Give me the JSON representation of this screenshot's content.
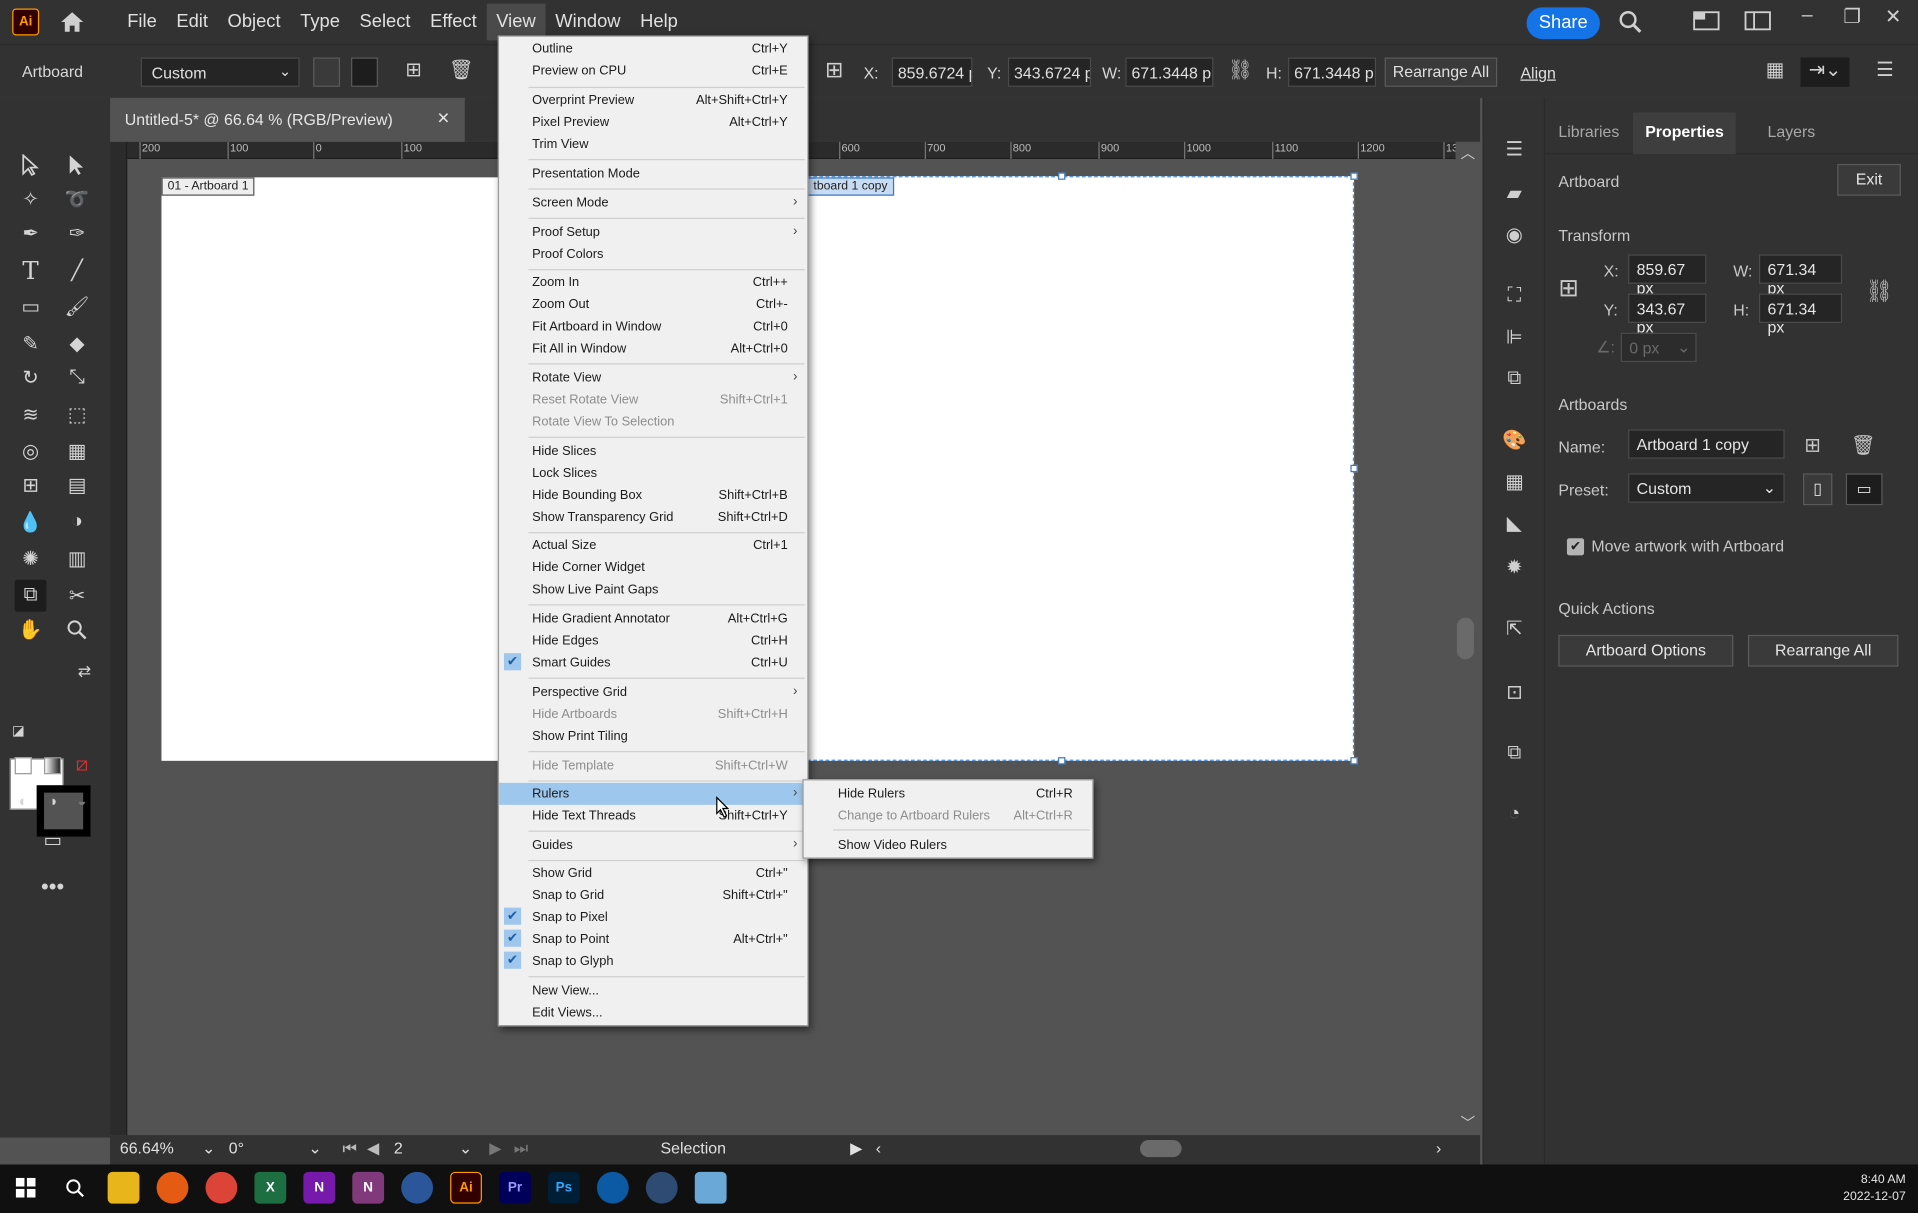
{
  "app": {
    "logo": "Ai",
    "menus": [
      "File",
      "Edit",
      "Object",
      "Type",
      "Select",
      "Effect",
      "View",
      "Window",
      "Help"
    ],
    "active_menu": "View",
    "share": "Share"
  },
  "controlbar": {
    "label": "Artboard",
    "preset": "Custom",
    "x_label": "X:",
    "x_value": "859.6724 p:",
    "y_label": "Y:",
    "y_value": "343.6724 p:",
    "w_label": "W:",
    "w_value": "671.3448 p:",
    "h_label": "H:",
    "h_value": "671.3448 p:",
    "rearrange": "Rearrange All",
    "align": "Align"
  },
  "document": {
    "tab_title": "Untitled-5* @ 66.64 % (RGB/Preview)",
    "close": "✕",
    "artboard1_label": "01 - Artboard 1",
    "artboard2_label": "tboard 1 copy",
    "ruler_h": [
      "200",
      "100",
      "0",
      "100",
      "600",
      "700",
      "800",
      "900",
      "1000",
      "1100",
      "1200",
      "13"
    ]
  },
  "view_menu": {
    "items": [
      {
        "label": "Outline",
        "shortcut": "Ctrl+Y"
      },
      {
        "label": "Preview on CPU",
        "shortcut": "Ctrl+E"
      },
      {
        "label": "Overprint Preview",
        "shortcut": "Alt+Shift+Ctrl+Y"
      },
      {
        "label": "Pixel Preview",
        "shortcut": "Alt+Ctrl+Y"
      },
      {
        "label": "Trim View",
        "shortcut": ""
      },
      {
        "label": "Presentation Mode",
        "shortcut": ""
      },
      {
        "label": "Screen Mode",
        "shortcut": ""
      },
      {
        "label": "Proof Setup",
        "shortcut": ""
      },
      {
        "label": "Proof Colors",
        "shortcut": ""
      },
      {
        "label": "Zoom In",
        "shortcut": "Ctrl++"
      },
      {
        "label": "Zoom Out",
        "shortcut": "Ctrl+-"
      },
      {
        "label": "Fit Artboard in Window",
        "shortcut": "Ctrl+0"
      },
      {
        "label": "Fit All in Window",
        "shortcut": "Alt+Ctrl+0"
      },
      {
        "label": "Rotate View",
        "shortcut": ""
      },
      {
        "label": "Reset Rotate View",
        "shortcut": "Shift+Ctrl+1"
      },
      {
        "label": "Rotate View To Selection",
        "shortcut": ""
      },
      {
        "label": "Hide Slices",
        "shortcut": ""
      },
      {
        "label": "Lock Slices",
        "shortcut": ""
      },
      {
        "label": "Hide Bounding Box",
        "shortcut": "Shift+Ctrl+B"
      },
      {
        "label": "Show Transparency Grid",
        "shortcut": "Shift+Ctrl+D"
      },
      {
        "label": "Actual Size",
        "shortcut": "Ctrl+1"
      },
      {
        "label": "Hide Corner Widget",
        "shortcut": ""
      },
      {
        "label": "Show Live Paint Gaps",
        "shortcut": ""
      },
      {
        "label": "Hide Gradient Annotator",
        "shortcut": "Alt+Ctrl+G"
      },
      {
        "label": "Hide Edges",
        "shortcut": "Ctrl+H"
      },
      {
        "label": "Smart Guides",
        "shortcut": "Ctrl+U"
      },
      {
        "label": "Perspective Grid",
        "shortcut": ""
      },
      {
        "label": "Hide Artboards",
        "shortcut": "Shift+Ctrl+H"
      },
      {
        "label": "Show Print Tiling",
        "shortcut": ""
      },
      {
        "label": "Hide Template",
        "shortcut": "Shift+Ctrl+W"
      },
      {
        "label": "Rulers",
        "shortcut": ""
      },
      {
        "label": "Hide Text Threads",
        "shortcut": "Shift+Ctrl+Y"
      },
      {
        "label": "Guides",
        "shortcut": ""
      },
      {
        "label": "Show Grid",
        "shortcut": "Ctrl+\""
      },
      {
        "label": "Snap to Grid",
        "shortcut": "Shift+Ctrl+\""
      },
      {
        "label": "Snap to Pixel",
        "shortcut": ""
      },
      {
        "label": "Snap to Point",
        "shortcut": "Alt+Ctrl+\""
      },
      {
        "label": "Snap to Glyph",
        "shortcut": ""
      },
      {
        "label": "New View...",
        "shortcut": ""
      },
      {
        "label": "Edit Views...",
        "shortcut": ""
      }
    ]
  },
  "rulers_submenu": {
    "items": [
      {
        "label": "Hide Rulers",
        "shortcut": "Ctrl+R"
      },
      {
        "label": "Change to Artboard Rulers",
        "shortcut": "Alt+Ctrl+R"
      },
      {
        "label": "Show Video Rulers",
        "shortcut": ""
      }
    ]
  },
  "status": {
    "zoom": "66.64%",
    "rotation": "0°",
    "artboard_num": "2",
    "tool": "Selection"
  },
  "panel": {
    "tabs": [
      "Libraries",
      "Properties",
      "Layers"
    ],
    "active_tab": "Properties",
    "section_title": "Artboard",
    "exit": "Exit",
    "transform_title": "Transform",
    "x_label": "X:",
    "x_value": "859.67 px",
    "y_label": "Y:",
    "y_value": "343.67 px",
    "w_label": "W:",
    "w_value": "671.34 px",
    "h_label": "H:",
    "h_value": "671.34 px",
    "angle_value": "0 px",
    "artboards_title": "Artboards",
    "name_label": "Name:",
    "name_value": "Artboard 1 copy",
    "preset_label": "Preset:",
    "preset_value": "Custom",
    "move_artwork": "Move artwork with Artboard",
    "quick_actions": "Quick Actions",
    "artboard_options": "Artboard Options",
    "rearrange_all": "Rearrange All"
  },
  "taskbar": {
    "time": "8:40 AM",
    "date": "2022-12-07"
  },
  "colors": {
    "accent": "#1473e6",
    "ui_dark": "#323232",
    "canvas": "#535353",
    "menu_highlight": "#9ec7ee"
  }
}
